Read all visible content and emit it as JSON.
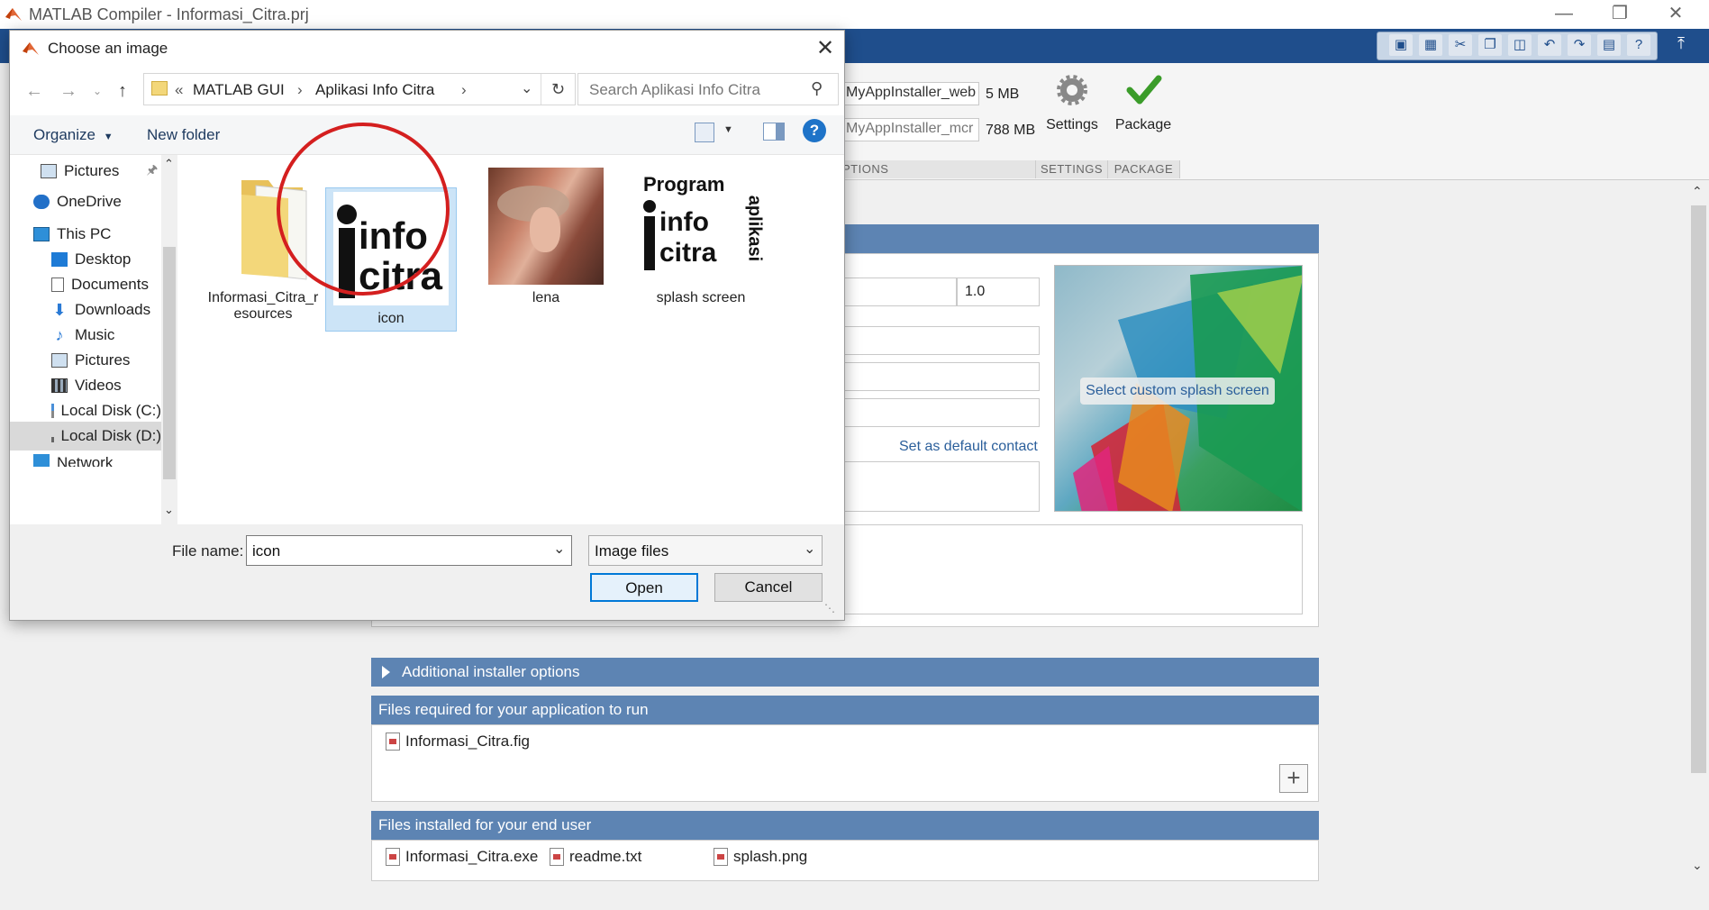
{
  "app": {
    "title": "MATLAB Compiler - Informasi_Citra.prj"
  },
  "ribbon": {
    "web_installer": "MyAppInstaller_web",
    "web_size": "5 MB",
    "mcr_installer": "MyAppInstaller_mcr",
    "mcr_size": "788 MB",
    "settings_label": "Settings",
    "package_label": "Package",
    "section_options": "PTIONS",
    "section_settings": "SETTINGS",
    "section_package": "PACKAGE"
  },
  "project": {
    "version_value": "1.0",
    "splash_button": "Select custom splash screen",
    "default_contact_link": "Set as default contact",
    "additional_options": "Additional installer options",
    "files_required_header": "Files required for your application to run",
    "files_required": [
      "Informasi_Citra.fig"
    ],
    "files_installed_header": "Files installed for your end user",
    "files_installed": [
      "Informasi_Citra.exe",
      "readme.txt",
      "splash.png"
    ]
  },
  "dialog": {
    "title": "Choose an image",
    "breadcrumb": [
      "«",
      "MATLAB GUI",
      "›",
      "Aplikasi Info Citra",
      "›"
    ],
    "search_placeholder": "Search Aplikasi Info Citra",
    "organize_label": "Organize",
    "new_folder_label": "New folder",
    "nav_items": [
      "Pictures",
      "OneDrive",
      "This PC",
      "Desktop",
      "Documents",
      "Downloads",
      "Music",
      "Pictures",
      "Videos",
      "Local Disk (C:)",
      "Local Disk (D:)",
      "Network"
    ],
    "files": [
      {
        "name": "Informasi_Citra_resources",
        "line1": "Informasi_Citra_r",
        "line2": "esources"
      },
      {
        "name": "icon"
      },
      {
        "name": "lena"
      },
      {
        "name": "splash screen"
      }
    ],
    "icon_thumb_text": [
      "info",
      "citra"
    ],
    "splash_thumb_text": [
      "Program",
      "info",
      "citra",
      "aplikasi"
    ],
    "file_name_label": "File name:",
    "file_name_value": "icon",
    "file_type_value": "Image files",
    "open_label": "Open",
    "cancel_label": "Cancel"
  },
  "colors": {
    "ribbon_blue": "#1f4e8c",
    "panel_blue": "#5d84b3",
    "selection": "#cce4f7",
    "annotation_red": "#d41f1f"
  }
}
